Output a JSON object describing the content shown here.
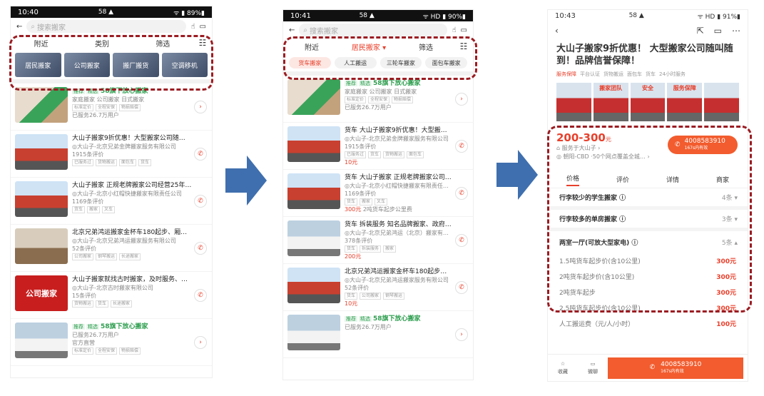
{
  "p1": {
    "status": {
      "time": "10:40",
      "icons": "58 ▲",
      "battery": "ᯤ ▮ 89%▮"
    },
    "search_placeholder": "搜索搬家",
    "filters": [
      "附近",
      "类别",
      "筛选"
    ],
    "cats": [
      "居民搬家",
      "公司搬家",
      "搬厂搬货",
      "空调移机"
    ],
    "items": [
      {
        "badges": [
          "推荐",
          "精选"
        ],
        "title": "58旗下放心搬家",
        "sub": "家庭搬家 公司搬家 日式搬家",
        "tags": [
          "标准定价",
          "全程安保",
          "物损赔偿"
        ],
        "extra": "已服务26.7万用户",
        "btn": "›",
        "thumb": "worker"
      },
      {
        "title": "大山子搬家9折优惠！大型搬家公司随…",
        "sub": "◎大山子-北京兄弟金牌搬家服务有限公司",
        "sub2": "1915条评价",
        "tags": [
          "已服务过",
          "货物搬运",
          "面包车",
          "货车"
        ],
        "btn": "✆",
        "thumb": "truck"
      },
      {
        "title": "大山子搬家 正规老牌搬家公司经营25年…",
        "sub": "◎大山子-北京小红帽快捷搬家有限责任公司",
        "sub2": "1169条评价",
        "tags": [
          "货车",
          "搬家",
          "叉车"
        ],
        "btn": "✆",
        "thumb": "truck"
      },
      {
        "title": "北京兄弟鸿运搬家金杯车180起步、厢…",
        "sub": "◎大山子-北京兄弟鸿运搬家服务有限公司",
        "sub2": "52条评价",
        "tags": [
          "公司搬家",
          "钢琴搬运",
          "长途搬家"
        ],
        "btn": "✆",
        "thumb": "room"
      },
      {
        "title": "大山子搬家就找古时搬家，及时服务、…",
        "sub": "◎大山子-北京古时搬家有限公司",
        "sub2": "15条评价",
        "tags": [
          "货物搬运",
          "货车",
          "长途搬家"
        ],
        "btn": "✆",
        "thumb": "sign",
        "thumb_text": "公司搬家"
      },
      {
        "badges": [
          "推荐",
          "精选"
        ],
        "title": "58旗下放心搬家",
        "sub": "已服务26.7万用户",
        "sub2": "官方直营",
        "tags": [
          "标准定价",
          "全程安保",
          "物损赔偿"
        ],
        "btn": "›",
        "thumb": "van"
      }
    ]
  },
  "p2": {
    "status": {
      "time": "10:41",
      "icons": "58 ▲",
      "battery": "ᯤ HD ▮ 90%▮"
    },
    "search_placeholder": "搜索搬家",
    "filters": [
      "附近",
      "居民搬家 ▾",
      "筛选"
    ],
    "chips": [
      "货车搬家",
      "人工搬运",
      "三轮车搬家",
      "面包车搬家"
    ],
    "items": [
      {
        "badges": [
          "推荐",
          "精选"
        ],
        "title": "58旗下放心搬家",
        "sub": "家庭搬家 公司搬家 日式搬家",
        "tags": [
          "标准定价",
          "全程安保",
          "物损赔偿"
        ],
        "extra": "已服务26.7万用户",
        "btn": "›",
        "thumb": "worker"
      },
      {
        "title": "货车 大山子搬家9折优惠！大型搬家公…",
        "sub": "◎大山子-北京兄弟金牌搬家服务有限公司",
        "sub2": "1915条评价",
        "tags": [
          "已服务过",
          "货车",
          "货物搬运",
          "面包车"
        ],
        "price": "10元",
        "btn": "✆",
        "thumb": "truck"
      },
      {
        "title": "货车 大山子搬家 正规老牌搬家公司经…",
        "sub": "◎大山子-北京小红帽快捷搬家有限责任公司",
        "sub2": "1169条评价",
        "tags": [
          "货车",
          "搬家",
          "叉车"
        ],
        "price": "300元",
        "price_note": "2吨货车起步公里费",
        "btn": "✆",
        "thumb": "truck"
      },
      {
        "title": "货车 拆装服务 知名品牌搬家、政府采…",
        "sub": "◎大山子-北京兄弟鸿运（北京）搬家有限责任公司",
        "sub2": "378条评价",
        "tags": [
          "货车",
          "拆装服务",
          "搬家"
        ],
        "price": "200元",
        "btn": "✆",
        "thumb": "van"
      },
      {
        "title": "北京兄弟鸿运搬家金杯车180起步、厢…",
        "sub": "◎大山子-北京兄弟鸿运搬家服务有限公司",
        "sub2": "52条评价",
        "tags": [
          "货车",
          "公司搬家",
          "钢琴搬运"
        ],
        "price": "10元",
        "btn": "✆",
        "thumb": "truck"
      },
      {
        "badges": [
          "推荐",
          "精选"
        ],
        "title": "58旗下放心搬家",
        "sub": "已服务26.7万用户",
        "tags": [],
        "btn": "›",
        "thumb": "van"
      }
    ]
  },
  "p3": {
    "status": {
      "time": "10:43",
      "icons": "58 ▲",
      "battery": "ᯤ HD ▮ 91%▮"
    },
    "title": "大山子搬家9折优惠！ 大型搬家公司随叫随到！品牌信誉保障！",
    "tags": [
      "服务保障",
      "平台认证",
      "货物搬运",
      "面包车",
      "货车",
      "24小时服务"
    ],
    "photo_labels": [
      "",
      "搬家团队",
      "安全",
      "服务保障",
      ""
    ],
    "price": "200-300",
    "price_unit": "元",
    "shop": "⌂ 服务于大山子 ›",
    "addr": "◎ 朝阳-CBD ·50个网点覆盖全城… ›",
    "phone": "4008583910",
    "phone_note": "167s内有效",
    "tabs": [
      "价格",
      "评价",
      "详情",
      "商家"
    ],
    "sections": [
      {
        "label": "行李较少的学生搬家 ⓘ",
        "count": "4条 ▾"
      },
      {
        "label": "行李较多的单房搬家 ⓘ",
        "count": "3条 ▾"
      },
      {
        "label": "两室一厅(可放大型家电) ⓘ",
        "count": "5条 ▴"
      }
    ],
    "rows": [
      {
        "label": "1.5吨货车起步价(含10公里)",
        "price": "300元"
      },
      {
        "label": "2吨货车起步价(含10公里)",
        "price": "300元"
      },
      {
        "label": "2吨货车起步",
        "price": "300元"
      },
      {
        "label": "2.5吨货车起步价(含10公里)",
        "price": "300元"
      },
      {
        "label": "人工搬运费（元/人/小时）",
        "price": "100元"
      }
    ],
    "bottom": {
      "fav": "收藏",
      "chat": "微聊",
      "phone": "4008583910",
      "note": "167s内有效"
    }
  },
  "colors": {
    "accent": "#e8402c",
    "dash": "#9b1c22",
    "arrow": "#3f6fae"
  }
}
